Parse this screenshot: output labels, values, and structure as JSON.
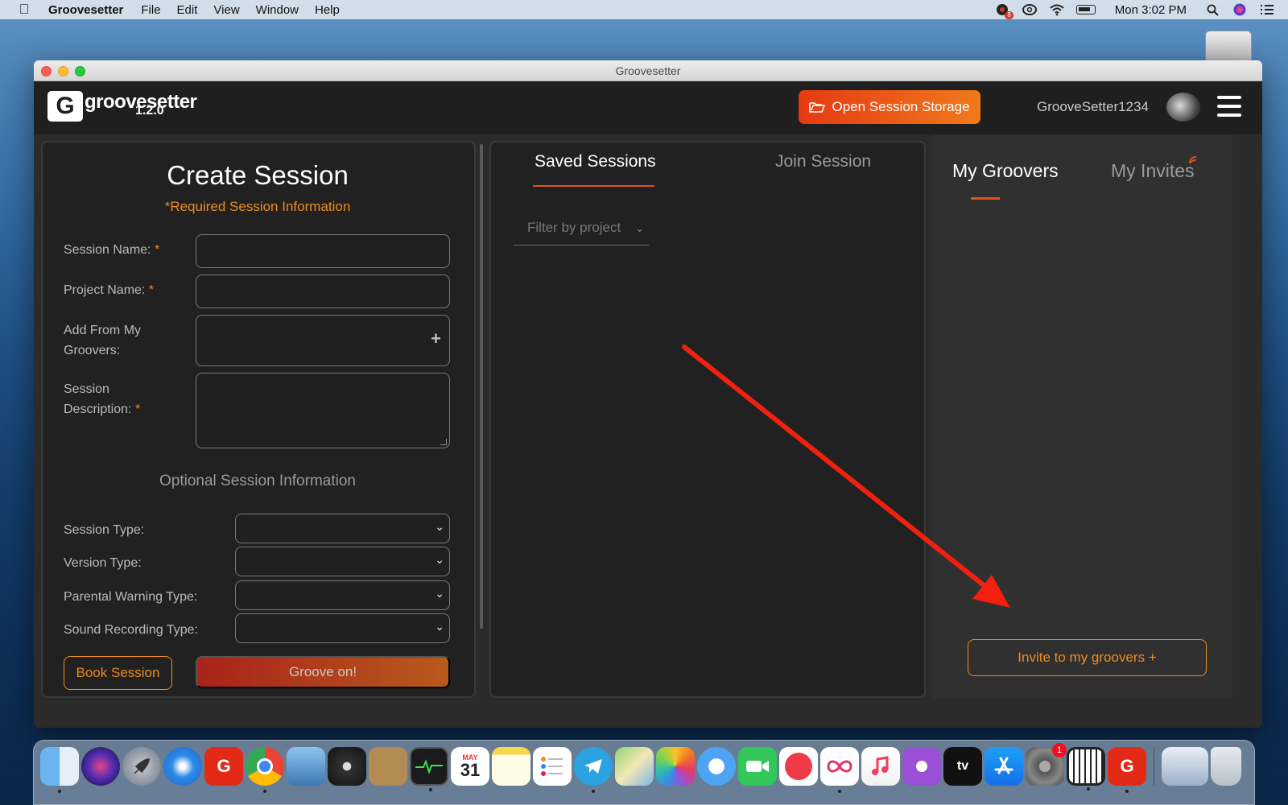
{
  "menubar": {
    "apple_icon": "apple-icon",
    "app_name": "Groovesetter",
    "menus": [
      "File",
      "Edit",
      "View",
      "Window",
      "Help"
    ],
    "clock": "Mon 3:02 PM",
    "notification_badge": "8"
  },
  "window": {
    "title": "Groovesetter"
  },
  "header": {
    "logo_mark": "G",
    "logo_text": "groovesetter",
    "version": "1.2.0",
    "storage_button": "Open Session Storage",
    "username": "GrooveSetter1234",
    "brand_gradient": [
      "#e63a12",
      "#f07a1c"
    ]
  },
  "create": {
    "title": "Create Session",
    "required_note": "*Required Session Information",
    "session_name_label": "Session Name:",
    "project_name_label": "Project Name:",
    "add_groovers_label_1": "Add From My",
    "add_groovers_label_2": "Groovers:",
    "description_label_1": "Session",
    "description_label_2": "Description:",
    "required_star": "*",
    "add_icon": "+",
    "optional_title": "Optional Session Information",
    "session_type_label": "Session Type:",
    "version_type_label": "Version Type:",
    "parental_label": "Parental Warning Type:",
    "sound_recording_label": "Sound Recording Type:",
    "book_button": "Book Session",
    "groove_button": "Groove on!"
  },
  "sessions": {
    "tabs": [
      "Saved Sessions",
      "Join Session"
    ],
    "active_tab": "Saved Sessions",
    "filter_placeholder": "Filter by project"
  },
  "groovers": {
    "tabs": [
      "My Groovers",
      "My Invites"
    ],
    "active_tab": "My Groovers",
    "invite_button": "Invite to my groovers +"
  },
  "dock": {
    "apps": [
      "finder-icon",
      "siri-icon",
      "launchpad-icon",
      "safari-icon",
      "groovesetter-icon",
      "chrome-icon",
      "preview-icon",
      "dvd-player-icon",
      "contacts-icon",
      "activity-monitor-icon",
      "calendar-icon",
      "notes-icon",
      "reminders-icon",
      "telegram-icon",
      "maps-icon",
      "photos-icon",
      "messages-icon",
      "facetime-icon",
      "news-icon",
      "infinity-icon",
      "music-icon",
      "podcasts-icon",
      "tv-icon",
      "app-store-icon",
      "system-preferences-icon",
      "piano-icon",
      "groovesetter-icon",
      "downloads-icon",
      "trash-icon"
    ],
    "calendar_day": "31",
    "calendar_month": "MAY",
    "settings_badge": "1",
    "tv_label": "tv",
    "groovesetter_letter": "G"
  },
  "colors": {
    "accent": "#f08a1e",
    "accent_red": "#e0521a",
    "panel": "#212121",
    "window_bg": "#2b2b2b"
  }
}
